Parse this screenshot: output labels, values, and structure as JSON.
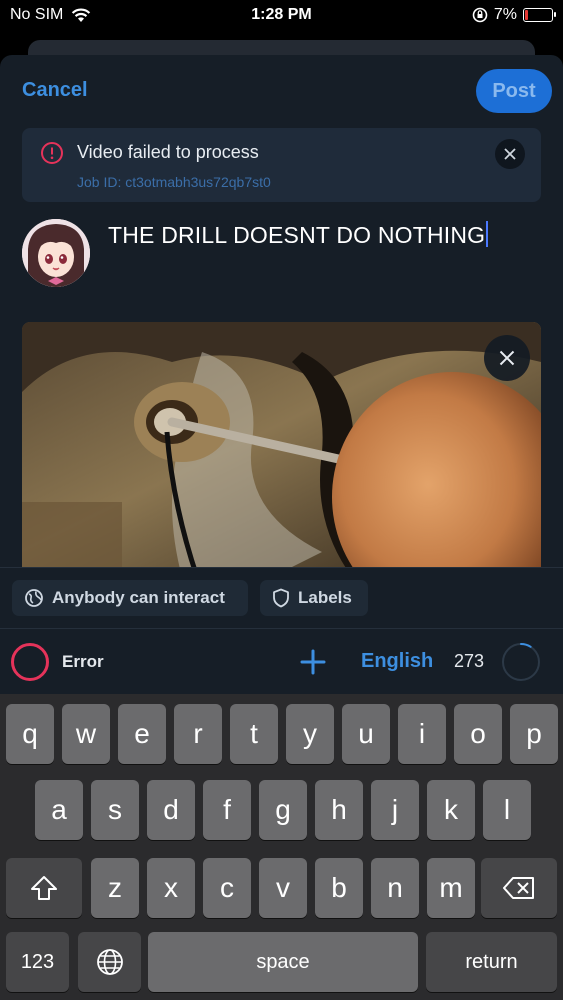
{
  "status_bar": {
    "carrier": "No SIM",
    "time": "1:28 PM",
    "battery": "7%"
  },
  "header": {
    "cancel_label": "Cancel",
    "post_label": "Post"
  },
  "error_banner": {
    "message": "Video failed to process",
    "job_id": "Job ID: ct3otmabh3us72qb7st0"
  },
  "composer": {
    "text": "THE DRILL DOESNT DO NOTHING"
  },
  "pills": {
    "interaction": "Anybody can interact",
    "labels": "Labels"
  },
  "toolbar": {
    "status": "Error",
    "language": "English",
    "char_count": "273",
    "char_progress": 0.09
  },
  "keyboard": {
    "row1": [
      "q",
      "w",
      "e",
      "r",
      "t",
      "y",
      "u",
      "i",
      "o",
      "p"
    ],
    "row2": [
      "a",
      "s",
      "d",
      "f",
      "g",
      "h",
      "j",
      "k",
      "l"
    ],
    "row3": [
      "z",
      "x",
      "c",
      "v",
      "b",
      "n",
      "m"
    ],
    "numbers_key": "123",
    "space_key": "space",
    "return_key": "return"
  },
  "colors": {
    "accent": "#3d8fe0",
    "post_button": "#1d6fd6",
    "error": "#e5335a",
    "background": "#161e27"
  }
}
